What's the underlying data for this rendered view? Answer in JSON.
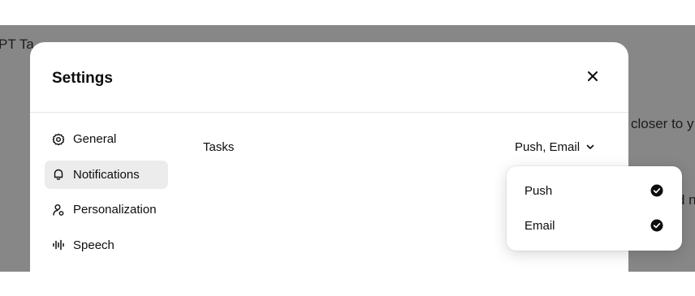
{
  "background": {
    "title_fragment": "PT Ta",
    "line1_fragment": "closer to y",
    "line2_fragment": "d n"
  },
  "modal": {
    "title": "Settings",
    "close_icon": "close-icon"
  },
  "sidebar": {
    "items": [
      {
        "label": "General",
        "icon": "gear-icon",
        "active": false
      },
      {
        "label": "Notifications",
        "icon": "bell-icon",
        "active": true
      },
      {
        "label": "Personalization",
        "icon": "person-icon",
        "active": false
      },
      {
        "label": "Speech",
        "icon": "waveform-icon",
        "active": false
      }
    ]
  },
  "content": {
    "tasks_label": "Tasks",
    "selected_value": "Push, Email"
  },
  "dropdown": {
    "options": [
      {
        "label": "Push",
        "checked": true
      },
      {
        "label": "Email",
        "checked": true
      }
    ]
  },
  "colors": {
    "backdrop": "#878787",
    "active_nav_bg": "#ececec",
    "text": "#0d0d0d"
  }
}
